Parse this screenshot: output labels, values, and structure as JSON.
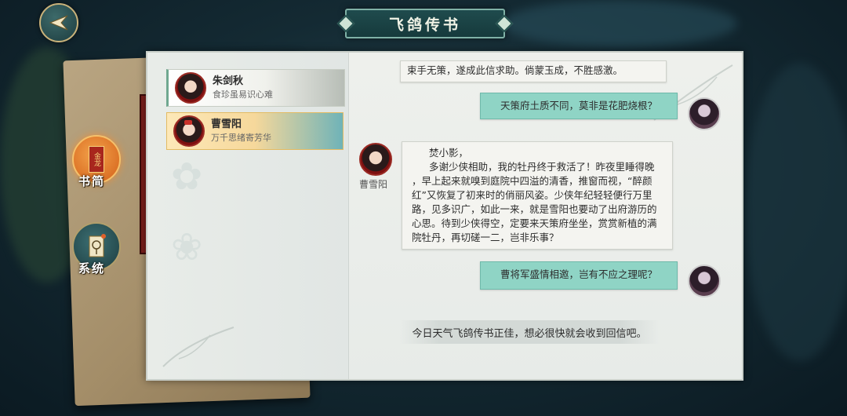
{
  "header": {
    "title": "飞鸽传书"
  },
  "sidebar": {
    "tabs": [
      {
        "label": "书简",
        "seal_text": "金龙"
      },
      {
        "label": "系统"
      }
    ]
  },
  "contacts": [
    {
      "name": "朱剑秋",
      "subtitle": "食珍虽易识心难",
      "active": false
    },
    {
      "name": "曹雪阳",
      "subtitle": "万千思绪寄芳华",
      "active": true
    }
  ],
  "chat": {
    "messages": [
      {
        "direction": "in",
        "sender": "",
        "text": "束手无策，遂成此信求助。倘蒙玉成，不胜感激。"
      },
      {
        "direction": "out",
        "sender": "",
        "text": "天策府土质不同，莫非是花肥烧根？"
      },
      {
        "direction": "in",
        "sender": "曹雪阳",
        "lines": [
          "焚小影，",
          "多谢少侠相助，我的牡丹终于救活了！昨夜里睡得晚",
          "，早上起来就嗅到庭院中四溢的清香，推窗而视，“醉颜",
          "红”又恢复了初来时的俏丽风姿。少侠年纪轻轻便行万里",
          "路，见多识广，如此一来，就是雪阳也要动了出府游历的",
          "心思。待到少侠得空，定要来天策府坐坐，赏赏新植的满",
          "院牡丹，再切磋一二，岂非乐事？"
        ]
      },
      {
        "direction": "out",
        "sender": "",
        "text": "曹将军盛情相邀，岂有不应之理呢？"
      }
    ],
    "notice": "今日天气飞鸽传书正佳，想必很快就会收到回信吧。"
  },
  "colors": {
    "outgoing_bubble": "#8fd4c5",
    "active_contact": "#f6d89b",
    "accent_orange": "#e07a25"
  }
}
